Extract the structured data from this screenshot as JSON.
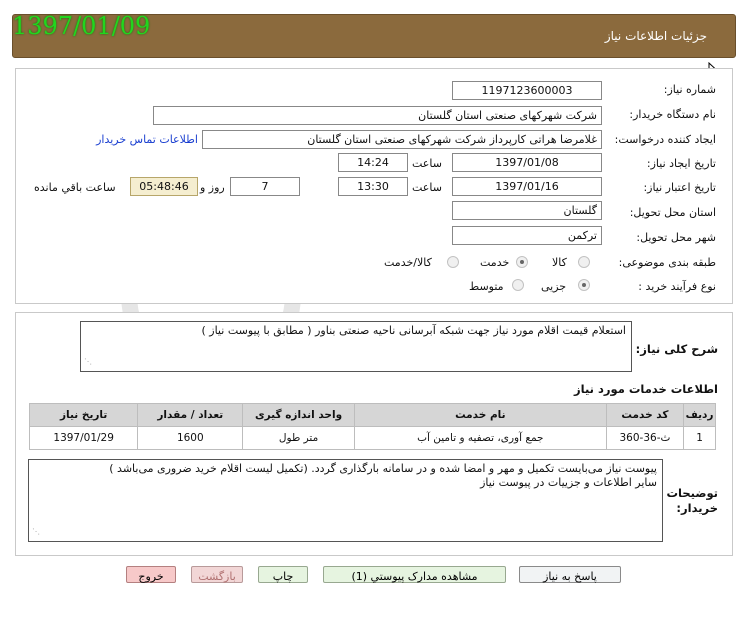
{
  "stamp_date": "1397/01/09",
  "header": {
    "title": "جزئیات اطلاعات نیاز"
  },
  "fields": {
    "need_number_label": "شماره نیاز:",
    "need_number": "1197123600003",
    "buyer_org_label": "نام دستگاه خریدار:",
    "buyer_org": "شرکت شهرکهای صنعتی استان گلستان",
    "requester_label": "ایجاد کننده درخواست:",
    "requester": "غلامرضا هراتی کارپرداز شرکت شهرکهای صنعتی استان گلستان",
    "contact_link": "اطلاعات تماس خریدار",
    "created_label": "تاریخ ایجاد نیاز:",
    "created_date": "1397/01/08",
    "created_time_label": "ساعت",
    "created_time": "14:24",
    "valid_label": "تاریخ اعتبار نیاز:",
    "valid_date": "1397/01/16",
    "valid_time_label": "ساعت",
    "valid_time": "13:30",
    "days": "7",
    "days_label": "روز و",
    "remaining": "05:48:46",
    "remaining_label": "ساعت باقي مانده",
    "province_label": "استان محل تحویل:",
    "province": "گلستان",
    "city_label": "شهر محل تحویل:",
    "city": "ترکمن",
    "category_label": "طبقه بندی موضوعی:",
    "category_options": [
      "کالا",
      "خدمت",
      "کالا/خدمت"
    ],
    "category_selected": "خدمت",
    "process_label": "نوع فرآیند خرید :",
    "process_options": [
      "جزیی",
      "متوسط"
    ],
    "process_selected": "جزیی"
  },
  "description": {
    "label": "شرح کلی نیاز:",
    "text": "استعلام قیمت اقلام مورد نیاز جهت شبکه آبرسانی ناحیه صنعتی بناور ( مطابق با پیوست نیاز )"
  },
  "services": {
    "title": "اطلاعات خدمات مورد نیاز",
    "columns": [
      "ردیف",
      "کد خدمت",
      "نام خدمت",
      "واحد اندازه گیری",
      "تعداد / مقدار",
      "تاریخ نیاز"
    ],
    "rows": [
      [
        "1",
        "ث-36-360",
        "جمع آوری، تصفیه و تامین آب",
        "متر طول",
        "1600",
        "1397/01/29"
      ]
    ]
  },
  "buyer_notes": {
    "label": "توضیحات خریدار:",
    "line1": "پیوست نیاز می‌بایست تکمیل و مهر و امضا شده و در سامانه بارگذاری گردد. (تکمیل لیست اقلام خرید ضروری می‌باشد )",
    "line2": "سایر اطلاعات و جزییات در پیوست نیاز"
  },
  "buttons": {
    "reply": "پاسخ به نیاز",
    "attachments": "مشاهده مدارک پیوستي (1)",
    "print": "چاپ",
    "back": "بازگشت",
    "exit": "خروج"
  },
  "watermark": "هزاره",
  "colors": {
    "header": "#8b6a3d",
    "stamp": "#22d61e",
    "link": "#1a3fd0"
  }
}
